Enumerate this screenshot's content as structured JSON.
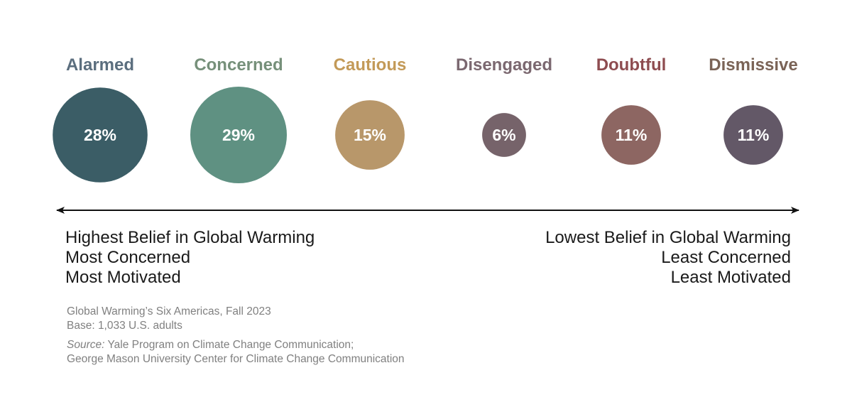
{
  "chart_data": {
    "type": "bubble",
    "title": "",
    "categories": [
      "Alarmed",
      "Concerned",
      "Cautious",
      "Disengaged",
      "Doubtful",
      "Dismissive"
    ],
    "values": [
      28,
      29,
      15,
      6,
      11,
      11
    ],
    "value_labels": [
      "28%",
      "29%",
      "15%",
      "6%",
      "11%",
      "11%"
    ],
    "unit": "%",
    "segments": [
      {
        "name": "Alarmed",
        "value": 28,
        "label": "28%",
        "label_color": "#5b6e7e",
        "circle_color": "#3b5d66"
      },
      {
        "name": "Concerned",
        "value": 29,
        "label": "29%",
        "label_color": "#76907a",
        "circle_color": "#5f9182"
      },
      {
        "name": "Cautious",
        "value": 15,
        "label": "15%",
        "label_color": "#c39a58",
        "circle_color": "#b8976a"
      },
      {
        "name": "Disengaged",
        "value": 6,
        "label": "6%",
        "label_color": "#7b6870",
        "circle_color": "#76636a"
      },
      {
        "name": "Doubtful",
        "value": 11,
        "label": "11%",
        "label_color": "#8e4c50",
        "circle_color": "#8d6662"
      },
      {
        "name": "Dismissive",
        "value": 11,
        "label": "11%",
        "label_color": "#7a6356",
        "circle_color": "#635867"
      }
    ],
    "axis": {
      "type": "double-arrow",
      "left_labels": [
        "Highest Belief in Global Warming",
        "Most Concerned",
        "Most Motivated"
      ],
      "right_labels": [
        "Lowest Belief in Global Warming",
        "Least Concerned",
        "Least Motivated"
      ]
    },
    "legend": "none",
    "grid": false
  },
  "caption": {
    "line1": "Global Warming’s Six Americas, Fall 2023",
    "line2": "Base: 1,033 U.S. adults",
    "source_prefix": "Source:",
    "source_line1": " Yale Program on Climate Change Communication;",
    "source_line2": "George Mason University Center for Climate Change Communication"
  }
}
